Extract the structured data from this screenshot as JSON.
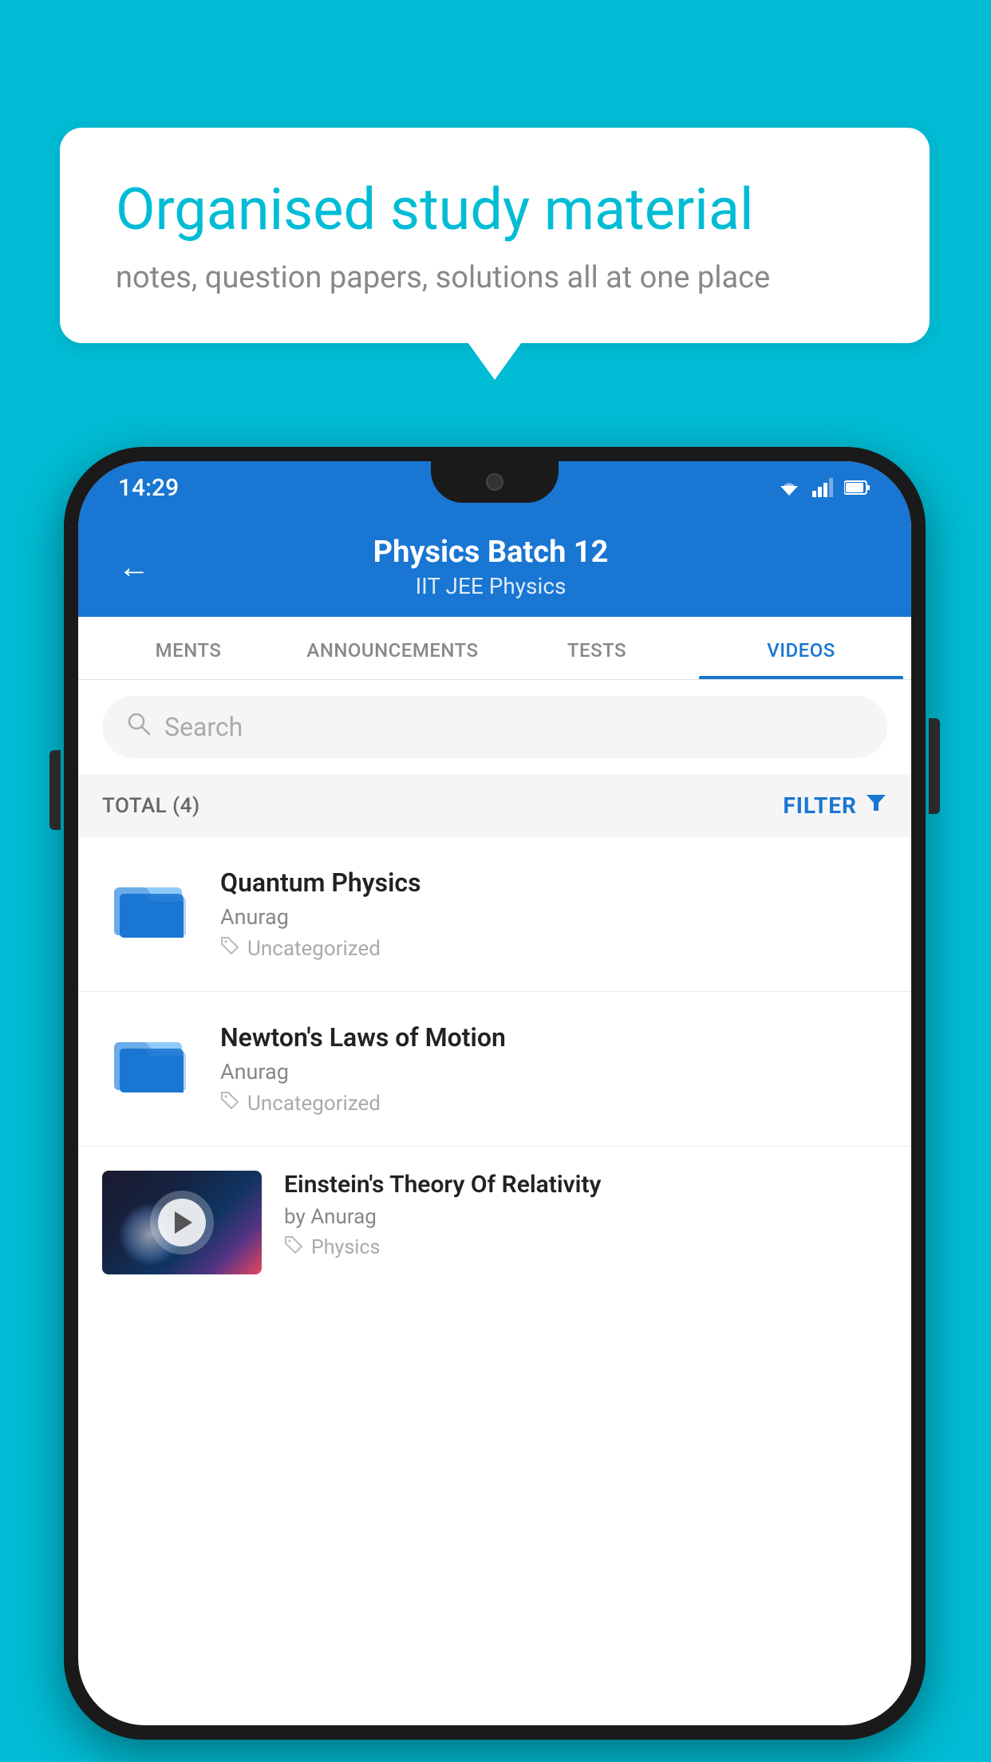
{
  "background_color": "#00BCD4",
  "bubble": {
    "title": "Organised study material",
    "subtitle": "notes, question papers, solutions all at one place"
  },
  "phone": {
    "status_bar": {
      "time": "14:29",
      "icons": [
        "wifi",
        "signal",
        "battery"
      ]
    },
    "app_bar": {
      "back_label": "←",
      "title": "Physics Batch 12",
      "subtitle": "IIT JEE   Physics"
    },
    "tabs": [
      {
        "label": "MENTS",
        "active": false
      },
      {
        "label": "ANNOUNCEMENTS",
        "active": false
      },
      {
        "label": "TESTS",
        "active": false
      },
      {
        "label": "VIDEOS",
        "active": true
      }
    ],
    "search": {
      "placeholder": "Search"
    },
    "filter_bar": {
      "total_label": "TOTAL (4)",
      "filter_label": "FILTER"
    },
    "videos": [
      {
        "id": 1,
        "title": "Quantum Physics",
        "author": "Anurag",
        "tag": "Uncategorized",
        "has_thumb": false
      },
      {
        "id": 2,
        "title": "Newton's Laws of Motion",
        "author": "Anurag",
        "tag": "Uncategorized",
        "has_thumb": false
      },
      {
        "id": 3,
        "title": "Einstein's Theory Of Relativity",
        "author": "by Anurag",
        "tag": "Physics",
        "has_thumb": true
      }
    ]
  }
}
